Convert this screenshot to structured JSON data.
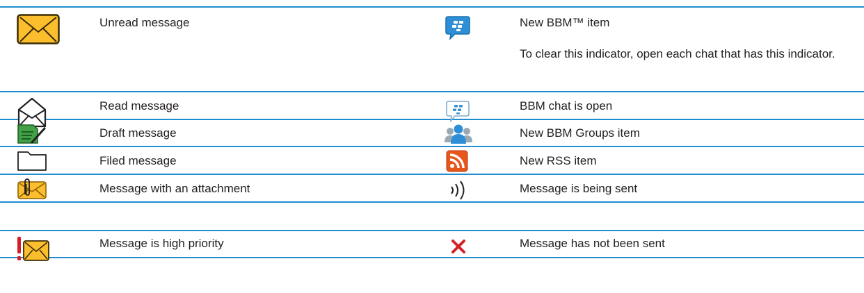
{
  "rows": [
    {
      "left": {
        "icon": "unread-envelope-icon",
        "label": "Unread message"
      },
      "right": {
        "icon": "bbm-new-item-icon",
        "label": "New BBM™ item",
        "note": "To clear this indicator, open each chat that has this indicator."
      }
    },
    {
      "left": {
        "icon": "read-envelope-icon",
        "label": "Read message"
      },
      "right": {
        "icon": "bbm-chat-open-icon",
        "label": "BBM chat is open"
      }
    },
    {
      "left": {
        "icon": "draft-message-icon",
        "label": "Draft message"
      },
      "right": {
        "icon": "bbm-groups-icon",
        "label": "New BBM Groups item"
      }
    },
    {
      "left": {
        "icon": "folder-icon",
        "label": "Filed message"
      },
      "right": {
        "icon": "rss-icon",
        "label": "New RSS item"
      }
    },
    {
      "left": {
        "icon": "attachment-envelope-icon",
        "label": "Message with an attachment"
      },
      "right": {
        "icon": "sending-waves-icon",
        "label": "Message is being sent"
      }
    },
    {
      "left": {
        "icon": "high-priority-envelope-icon",
        "label": "Message is high priority"
      },
      "right": {
        "icon": "not-sent-x-icon",
        "label": "Message has not been sent"
      }
    }
  ],
  "colors": {
    "rule": "#1f8ed1",
    "envelope_fill": "#fbbf2e",
    "bbm_blue": "#2f8fd6",
    "draft_green": "#43a047",
    "rss_orange": "#e8561c",
    "alert_red": "#d51f26"
  }
}
